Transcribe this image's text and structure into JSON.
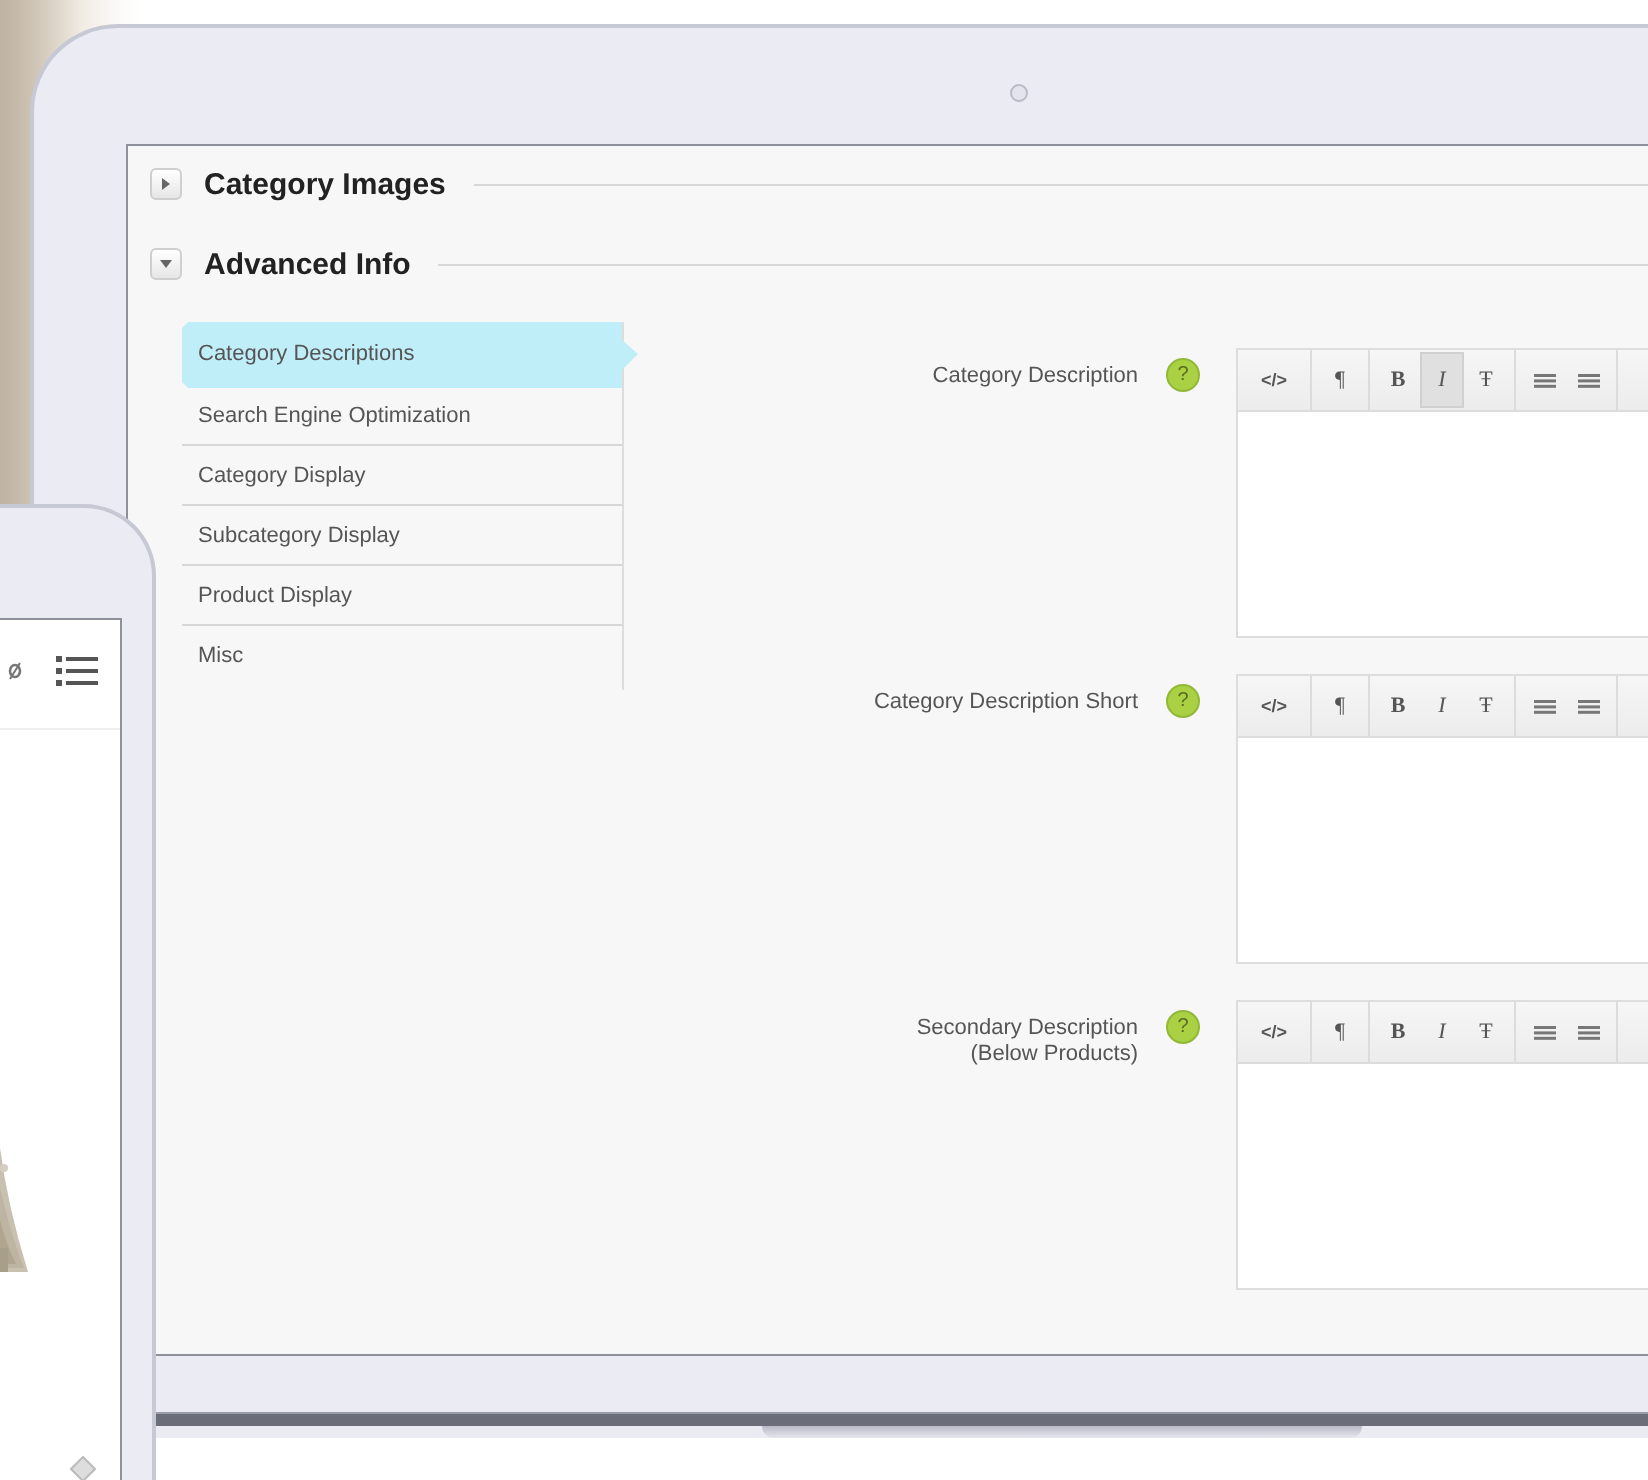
{
  "sections": [
    {
      "title": "Category Images",
      "expanded": false
    },
    {
      "title": "Advanced Info",
      "expanded": true
    }
  ],
  "tabs": [
    {
      "label": "Category Descriptions",
      "selected": true
    },
    {
      "label": "Search Engine Optimization",
      "selected": false
    },
    {
      "label": "Category Display",
      "selected": false
    },
    {
      "label": "Subcategory Display",
      "selected": false
    },
    {
      "label": "Product Display",
      "selected": false
    },
    {
      "label": "Misc",
      "selected": false
    }
  ],
  "fields": [
    {
      "label": "Category Description",
      "help": "?",
      "toolbar": [
        {
          "kind": "code",
          "label": "</>",
          "active": false
        },
        {
          "kind": "paragraph",
          "label": "¶",
          "active": false
        },
        {
          "kind": "bold",
          "label": "B",
          "active": false
        },
        {
          "kind": "italic",
          "label": "I",
          "active": true
        },
        {
          "kind": "strike",
          "label": "Ŧ",
          "active": false
        },
        {
          "kind": "list",
          "active": false
        },
        {
          "kind": "list",
          "active": false
        }
      ]
    },
    {
      "label": "Category Description Short",
      "help": "?",
      "toolbar": [
        {
          "kind": "code",
          "label": "</>",
          "active": false
        },
        {
          "kind": "paragraph",
          "label": "¶",
          "active": false
        },
        {
          "kind": "bold",
          "label": "B",
          "active": false
        },
        {
          "kind": "italic",
          "label": "I",
          "active": false
        },
        {
          "kind": "strike",
          "label": "Ŧ",
          "active": false
        },
        {
          "kind": "list",
          "active": false
        },
        {
          "kind": "list",
          "active": false
        }
      ]
    },
    {
      "label": "Secondary Description\n(Below Products)",
      "help": "?",
      "toolbar": [
        {
          "kind": "code",
          "label": "</>",
          "active": false
        },
        {
          "kind": "paragraph",
          "label": "¶",
          "active": false
        },
        {
          "kind": "bold",
          "label": "B",
          "active": false
        },
        {
          "kind": "italic",
          "label": "I",
          "active": false
        },
        {
          "kind": "strike",
          "label": "Ŧ",
          "active": false
        },
        {
          "kind": "list",
          "active": false
        },
        {
          "kind": "list",
          "active": false
        }
      ]
    }
  ]
}
